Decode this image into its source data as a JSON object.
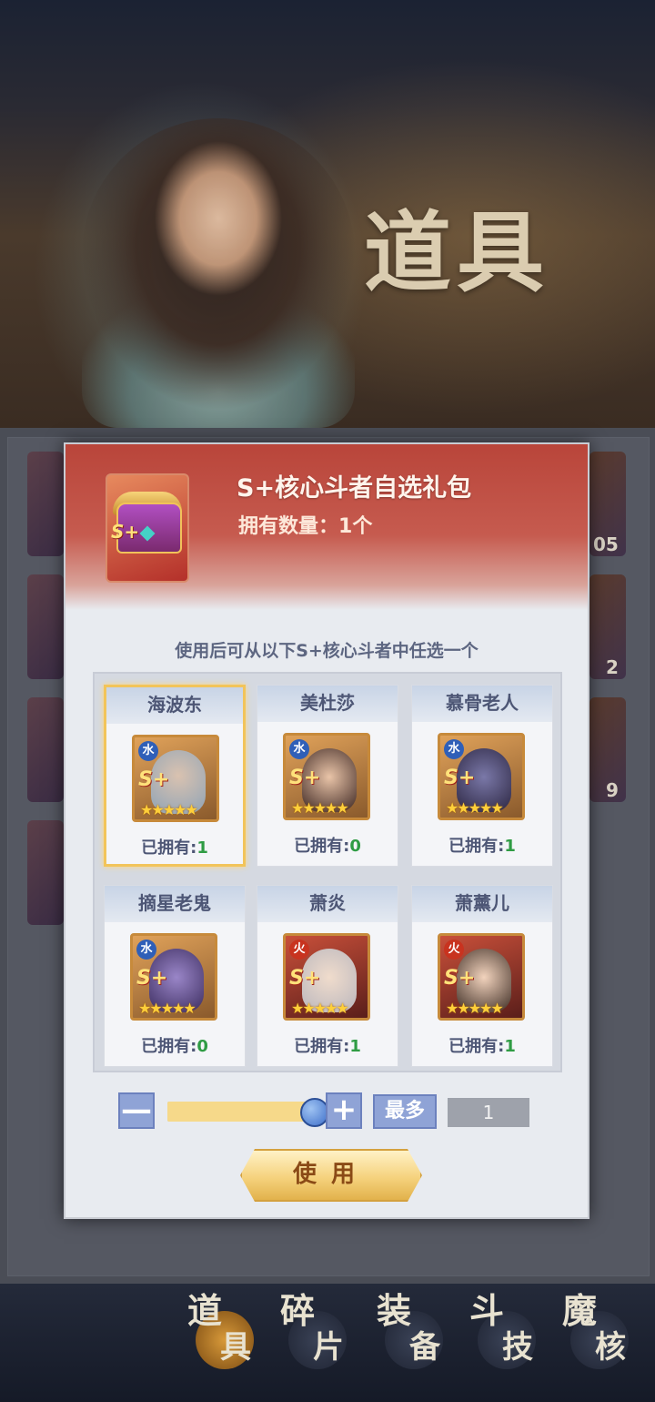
{
  "background": {
    "title": "道具",
    "side_counts": [
      "05",
      "2",
      "9"
    ],
    "tabs": [
      {
        "top": "道",
        "bottom": "具",
        "active": true
      },
      {
        "top": "碎",
        "bottom": "片",
        "active": false
      },
      {
        "top": "装",
        "bottom": "备",
        "active": false
      },
      {
        "top": "斗",
        "bottom": "技",
        "active": false
      },
      {
        "top": "魔",
        "bottom": "核",
        "active": false
      }
    ]
  },
  "dialog": {
    "item_name": "S+核心斗者自选礼包",
    "own_label": "拥有数量：",
    "own_value": "1个",
    "item_grade": "S+",
    "description": "使用后可从以下S+核心斗者中任选一个",
    "owned_label": "已拥有:",
    "heroes": [
      {
        "name": "海波东",
        "element": "水",
        "grade": "S+",
        "owned": "1",
        "selected": true
      },
      {
        "name": "美杜莎",
        "element": "水",
        "grade": "S+",
        "owned": "0",
        "selected": false
      },
      {
        "name": "慕骨老人",
        "element": "水",
        "grade": "S+",
        "owned": "1",
        "selected": false
      },
      {
        "name": "摘星老鬼",
        "element": "水",
        "grade": "S+",
        "owned": "0",
        "selected": false
      },
      {
        "name": "萧炎",
        "element": "火",
        "grade": "S+",
        "owned": "1",
        "selected": false
      },
      {
        "name": "萧薰儿",
        "element": "火",
        "grade": "S+",
        "owned": "1",
        "selected": false
      }
    ],
    "stars": "★★★★★",
    "minus_label": "—",
    "plus_label": "+",
    "slider_fraction": 1.0,
    "max_label": "最多",
    "quantity": "1",
    "use_label": "使用"
  }
}
